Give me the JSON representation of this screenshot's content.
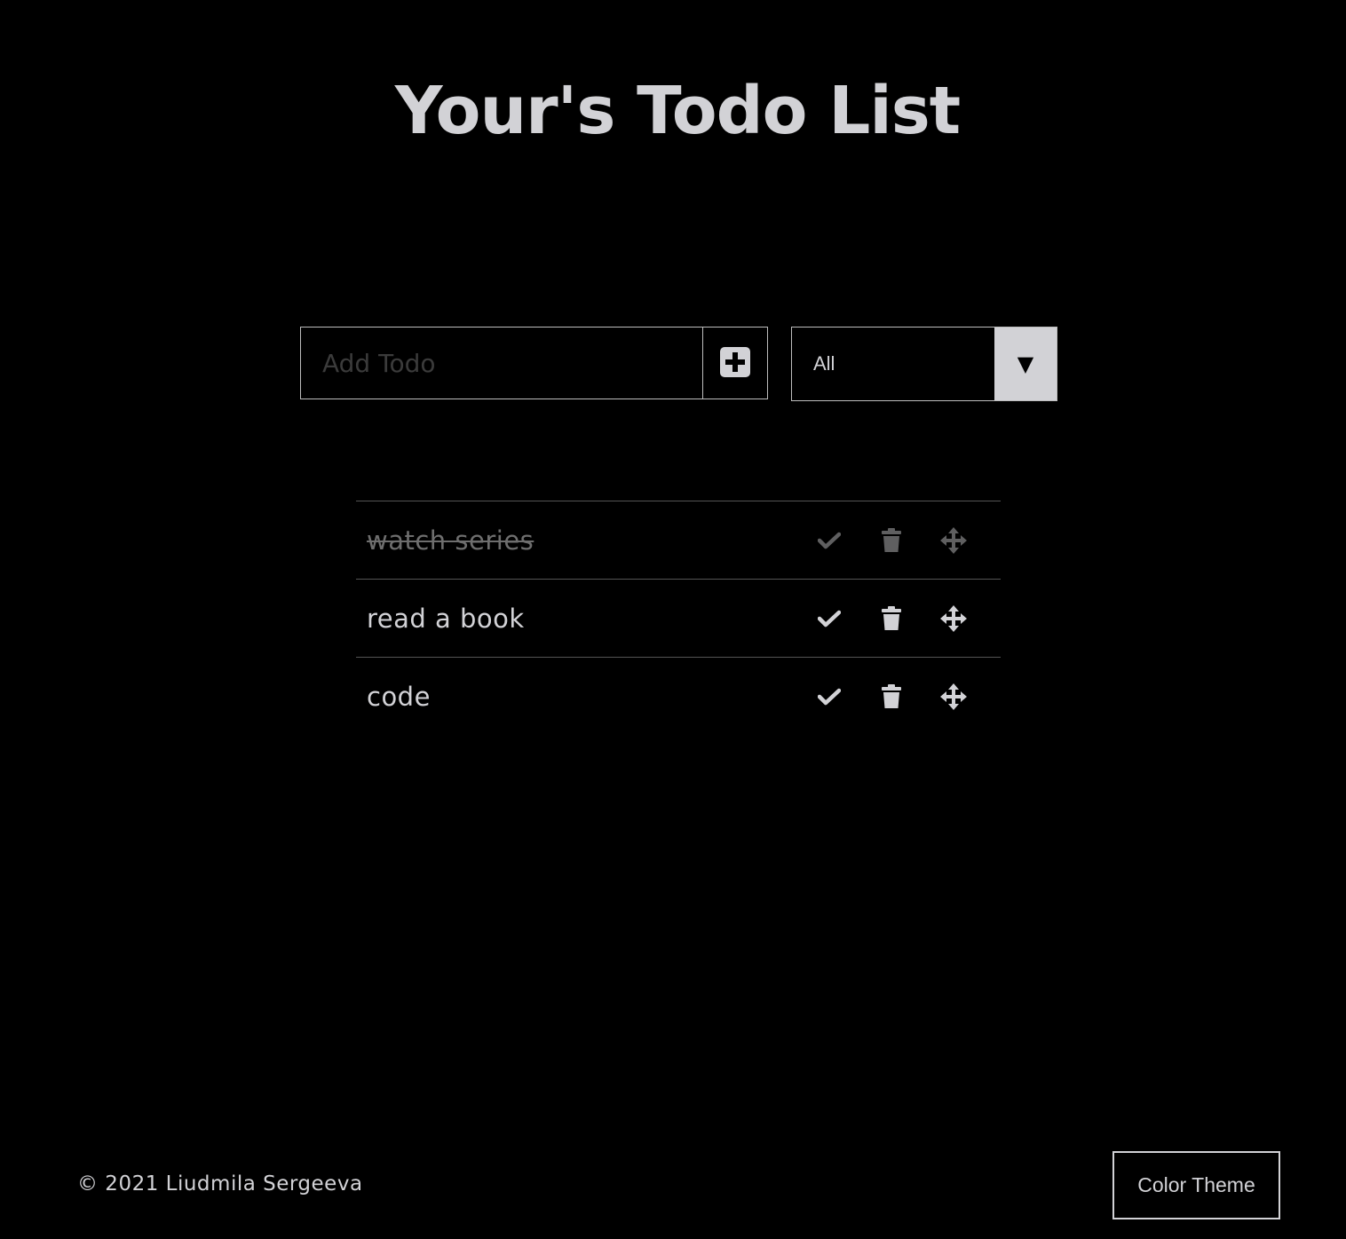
{
  "header": {
    "title": "Your's Todo List"
  },
  "add_form": {
    "placeholder": "Add Todo",
    "value": "",
    "add_icon": "plus-square-icon"
  },
  "filter": {
    "selected": "All",
    "arrow_glyph": "▼"
  },
  "todos": [
    {
      "text": "watch series",
      "completed": true
    },
    {
      "text": "read a book",
      "completed": false
    },
    {
      "text": "code",
      "completed": false
    }
  ],
  "todo_icons": {
    "complete": "check-icon",
    "delete": "trash-icon",
    "drag": "move-icon"
  },
  "footer": {
    "copyright": "© 2021 Liudmila Sergeeva",
    "theme_button": "Color Theme"
  },
  "colors": {
    "background": "#000000",
    "text": "#d2d2d6",
    "muted": "#6e6e6e",
    "border": "#555555"
  }
}
